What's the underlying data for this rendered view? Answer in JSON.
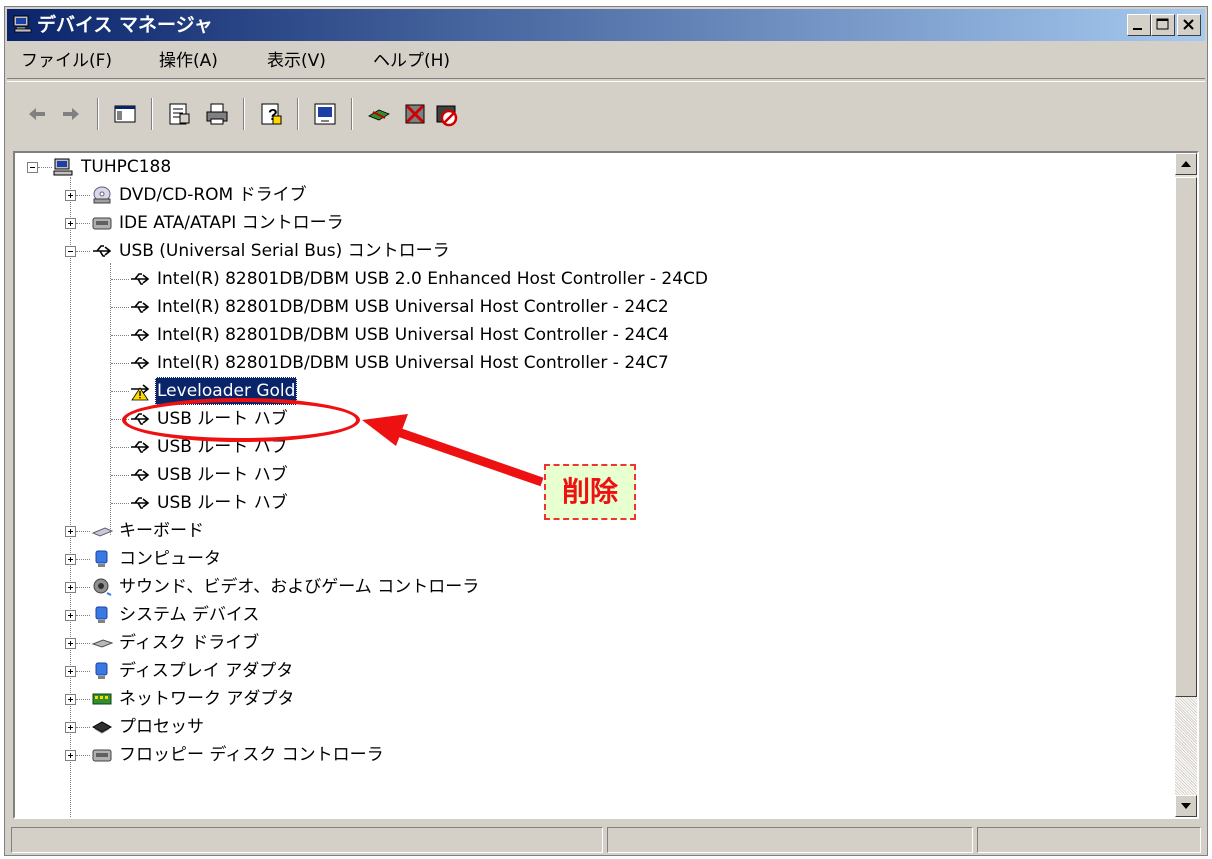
{
  "window": {
    "title": "デバイス マネージャ"
  },
  "menu": [
    {
      "label": "ファイル(F)"
    },
    {
      "label": "操作(A)"
    },
    {
      "label": "表示(V)"
    },
    {
      "label": "ヘルプ(H)"
    }
  ],
  "toolbar": {
    "icons": [
      "back-arrow-icon",
      "forward-arrow-icon",
      "show-hide-console-tree-icon",
      "properties-icon",
      "print-icon",
      "help-icon",
      "scan-hardware-icon",
      "update-driver-icon",
      "uninstall-icon",
      "disable-icon"
    ]
  },
  "tree": {
    "root": "TUHPC188",
    "categories": [
      {
        "label": "DVD/CD-ROM ドライブ"
      },
      {
        "label": "IDE ATA/ATAPI コントローラ"
      },
      {
        "label": "USB (Universal Serial Bus) コントローラ"
      },
      {
        "label": "キーボード"
      },
      {
        "label": "コンピュータ"
      },
      {
        "label": "サウンド、ビデオ、およびゲーム コントローラ"
      },
      {
        "label": "システム デバイス"
      },
      {
        "label": "ディスク ドライブ"
      },
      {
        "label": "ディスプレイ アダプタ"
      },
      {
        "label": "ネットワーク アダプタ"
      },
      {
        "label": "プロセッサ"
      },
      {
        "label": "フロッピー ディスク コントローラ"
      }
    ],
    "usb_children": [
      {
        "label": "Intel(R) 82801DB/DBM USB 2.0 Enhanced Host Controller - 24CD"
      },
      {
        "label": "Intel(R) 82801DB/DBM USB Universal Host Controller - 24C2"
      },
      {
        "label": "Intel(R) 82801DB/DBM USB Universal Host Controller - 24C4"
      },
      {
        "label": "Intel(R) 82801DB/DBM USB Universal Host Controller - 24C7"
      },
      {
        "label": "Leveloader Gold",
        "selected": true,
        "warning": true
      },
      {
        "label": "USB ルート ハブ"
      },
      {
        "label": "USB ルート ハブ"
      },
      {
        "label": "USB ルート ハブ"
      },
      {
        "label": "USB ルート ハブ"
      }
    ]
  },
  "annotation": {
    "label": "削除",
    "color": "#ee1111"
  },
  "colors": {
    "titlebar_start": "#0a246a",
    "titlebar_end": "#a6caf0",
    "selection": "#0a246a",
    "chrome": "#d4d0c8"
  }
}
